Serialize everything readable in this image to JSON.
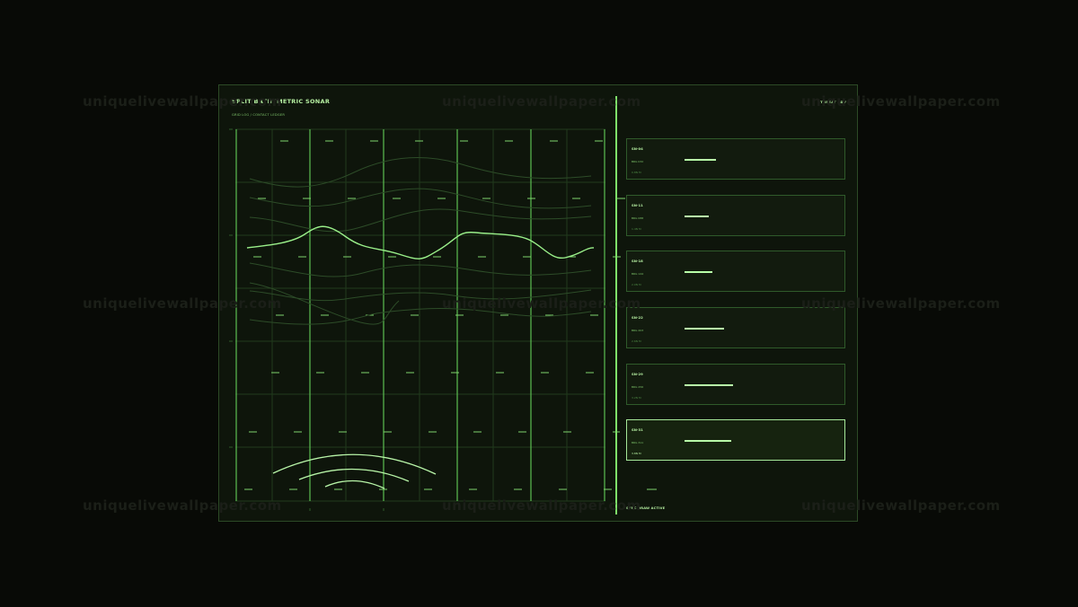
{
  "panel": {
    "title": "SPLIT BATHYMETRIC SONAR",
    "subtitle": "GRID LOG  / CONTACT LEDGER",
    "threat_label": "THREAT",
    "threat_value": "ADV",
    "status": "SYNC DRAW ACTIVE"
  },
  "sonar": {
    "colors": {
      "grid": "#213a1d",
      "bright": "#9af08a",
      "dim": "#2d4c28",
      "tick": "#7fd36c"
    }
  },
  "contacts": [
    {
      "id": "SN-04",
      "bearing": "BRG 032",
      "range": "0.8N M",
      "strength": 0.55,
      "active": false
    },
    {
      "id": "SN-11",
      "bearing": "BRG 088",
      "range": "1.4N M",
      "strength": 0.42,
      "active": false
    },
    {
      "id": "SN-18",
      "bearing": "BRG 144",
      "range": "2.0N M",
      "strength": 0.48,
      "active": false
    },
    {
      "id": "SN-22",
      "bearing": "BRG 203",
      "range": "2.6N M",
      "strength": 0.68,
      "active": false
    },
    {
      "id": "SN-29",
      "bearing": "BRG 256",
      "range": "3.2N M",
      "strength": 0.84,
      "active": false
    },
    {
      "id": "SN-31",
      "bearing": "BRG 311",
      "range": "3.8N M",
      "strength": 0.81,
      "active": true
    }
  ],
  "watermark": "uniquelivewallpaper.com"
}
